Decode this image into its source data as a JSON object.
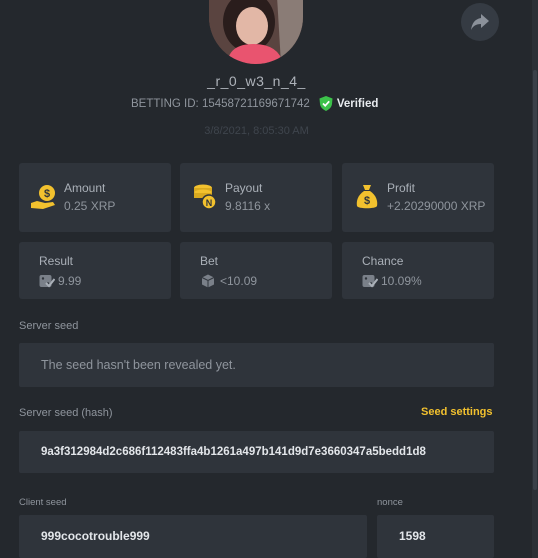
{
  "profile": {
    "username": "_r_0_w3_n_4_",
    "betting_id_label": "BETTING ID:",
    "betting_id": "15458721169671742",
    "verified_label": "Verified",
    "date": "3/8/2021, 8:05:30 AM"
  },
  "stats": [
    {
      "label": "Amount",
      "value": "0.25 XRP",
      "icon": "money-bag-dollar-icon"
    },
    {
      "label": "Payout",
      "value": "9.8116 x",
      "icon": "coin-stack-icon"
    },
    {
      "label": "Profit",
      "value": "+2.20290000 XRP",
      "icon": "money-sack-icon"
    }
  ],
  "details": [
    {
      "label": "Result",
      "value": "9.99",
      "icon": "dice-check-icon"
    },
    {
      "label": "Bet",
      "value": "<10.09",
      "icon": "dice-icon"
    },
    {
      "label": "Chance",
      "value": "10.09%",
      "icon": "dice-check-icon"
    }
  ],
  "server_seed": {
    "label": "Server seed",
    "value": "The seed hasn't been revealed yet."
  },
  "server_seed_hash": {
    "label": "Server seed (hash)",
    "value": "9a3f312984d2c686f112483ffa4b1261a497b141d9d7e3660347a5bedd1d8",
    "settings_label": "Seed settings"
  },
  "client_seed": {
    "label": "Client seed",
    "value": "999cocotrouble999"
  },
  "nonce": {
    "label": "nonce",
    "value": "1598"
  },
  "colors": {
    "background": "#24282d",
    "card": "#2f343b",
    "accent_yellow": "#f2c12e",
    "verified_green": "#3cc24a"
  }
}
